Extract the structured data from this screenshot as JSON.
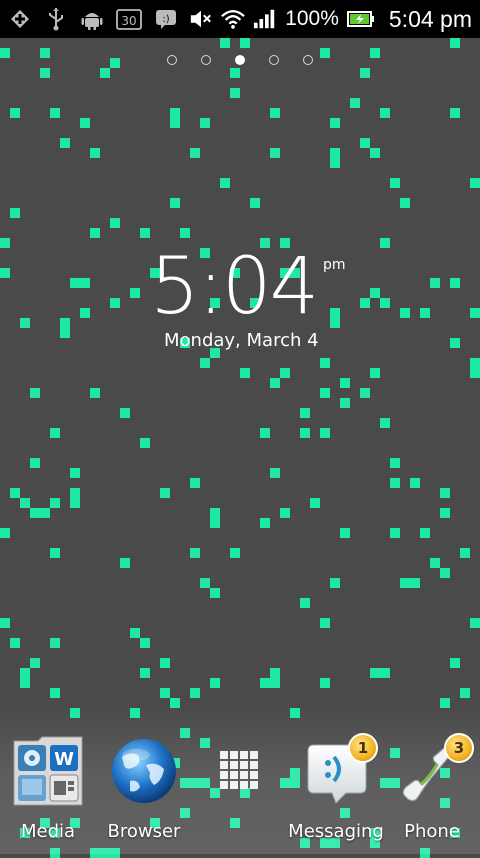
{
  "status_bar": {
    "battery_percent": "100%",
    "time": "5:04 pm",
    "calendar_day": "30",
    "left_icons": [
      "add-icon",
      "usb-icon",
      "android-debug-icon",
      "calendar-icon",
      "notification-icon"
    ],
    "right_icons": [
      "mute-icon",
      "wifi-icon",
      "signal-icon",
      "battery-icon"
    ]
  },
  "home": {
    "page_indicator": {
      "count": 5,
      "active_index": 2
    }
  },
  "clock_widget": {
    "time": "5:04",
    "ampm": "pm",
    "date": "Monday, March 4"
  },
  "dock": {
    "items": [
      {
        "label": "Media",
        "icon": "media-folder-icon"
      },
      {
        "label": "Browser",
        "icon": "globe-icon"
      },
      {
        "label": "",
        "icon": "app-drawer-icon"
      },
      {
        "label": "Messaging",
        "icon": "messaging-icon",
        "badge": "1"
      },
      {
        "label": "Phone",
        "icon": "phone-icon",
        "badge": "3"
      }
    ]
  },
  "colors": {
    "wallpaper_bg": "#4a4a4a",
    "pixel_accent": "#1de8a6",
    "badge": "#f2b322"
  }
}
